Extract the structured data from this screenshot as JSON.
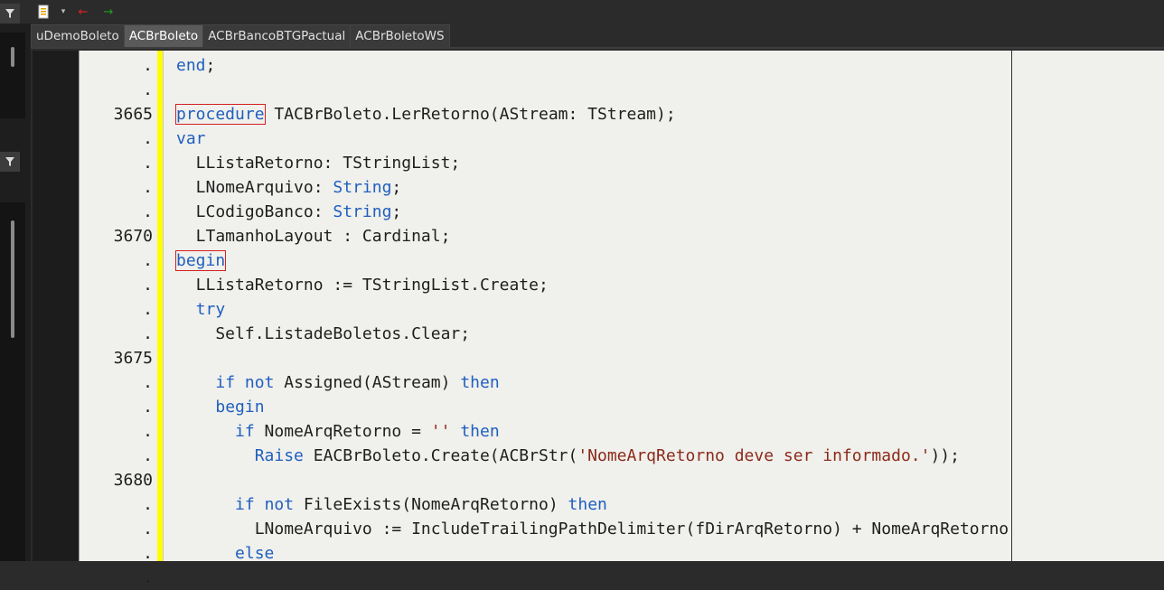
{
  "toolbar": {
    "icons": [
      "document-dropdown-icon",
      "chevron-down-icon",
      "back-arrow-icon",
      "forward-arrow-icon"
    ],
    "colors": {
      "back": "#e02020",
      "forward": "#20a020"
    }
  },
  "tabs": [
    {
      "label": "uDemoBoleto",
      "active": false
    },
    {
      "label": "ACBrBoleto",
      "active": true
    },
    {
      "label": "ACBrBancoBTGPactual",
      "active": false
    },
    {
      "label": "ACBrBoletoWS",
      "active": false
    }
  ],
  "editor": {
    "colors": {
      "keyword": "#1f5fbf",
      "string": "#8b2a1a",
      "text": "#1e1e1e",
      "background": "#f0f0ec",
      "modified_bar": "#ffff00",
      "bracket_highlight": "#d42020"
    },
    "gutter": [
      ".",
      ".",
      "3665",
      ".",
      ".",
      ".",
      ".",
      "3670",
      ".",
      ".",
      ".",
      ".",
      "3675",
      ".",
      ".",
      ".",
      ".",
      "3680",
      ".",
      ".",
      ".",
      "."
    ],
    "lines": [
      [
        {
          "t": "end",
          "k": "kw"
        },
        {
          "t": ";"
        }
      ],
      [],
      [
        {
          "t": "procedure",
          "k": "kw",
          "box": true
        },
        {
          "t": " TACBrBoleto.LerRetorno(AStream: TStream);"
        }
      ],
      [
        {
          "t": "var",
          "k": "kw"
        }
      ],
      [
        {
          "t": "  LListaRetorno: TStringList;"
        }
      ],
      [
        {
          "t": "  LNomeArquivo: "
        },
        {
          "t": "String",
          "k": "kw"
        },
        {
          "t": ";"
        }
      ],
      [
        {
          "t": "  LCodigoBanco: "
        },
        {
          "t": "String",
          "k": "kw"
        },
        {
          "t": ";"
        }
      ],
      [
        {
          "t": "  LTamanhoLayout : Cardinal;"
        }
      ],
      [
        {
          "t": "begin",
          "k": "kw",
          "box": true
        }
      ],
      [
        {
          "t": "  LListaRetorno := TStringList.Create;"
        }
      ],
      [
        {
          "t": "  "
        },
        {
          "t": "try",
          "k": "kw"
        }
      ],
      [
        {
          "t": "    Self.ListadeBoletos.Clear;"
        }
      ],
      [],
      [
        {
          "t": "    "
        },
        {
          "t": "if",
          "k": "kw"
        },
        {
          "t": " "
        },
        {
          "t": "not",
          "k": "kw"
        },
        {
          "t": " Assigned(AStream) "
        },
        {
          "t": "then",
          "k": "kw"
        }
      ],
      [
        {
          "t": "    "
        },
        {
          "t": "begin",
          "k": "kw"
        }
      ],
      [
        {
          "t": "      "
        },
        {
          "t": "if",
          "k": "kw"
        },
        {
          "t": " NomeArqRetorno = "
        },
        {
          "t": "''",
          "k": "str"
        },
        {
          "t": " "
        },
        {
          "t": "then",
          "k": "kw"
        }
      ],
      [
        {
          "t": "        "
        },
        {
          "t": "Raise",
          "k": "kw"
        },
        {
          "t": " EACBrBoleto.Create(ACBrStr("
        },
        {
          "t": "'NomeArqRetorno deve ser informado.'",
          "k": "str"
        },
        {
          "t": "));"
        }
      ],
      [],
      [
        {
          "t": "      "
        },
        {
          "t": "if",
          "k": "kw"
        },
        {
          "t": " "
        },
        {
          "t": "not",
          "k": "kw"
        },
        {
          "t": " FileExists(NomeArqRetorno) "
        },
        {
          "t": "then",
          "k": "kw"
        }
      ],
      [
        {
          "t": "        LNomeArquivo := IncludeTrailingPathDelimiter(fDirArqRetorno) + NomeArqRetorno"
        }
      ],
      [
        {
          "t": "      "
        },
        {
          "t": "else",
          "k": "kw"
        }
      ],
      []
    ]
  }
}
